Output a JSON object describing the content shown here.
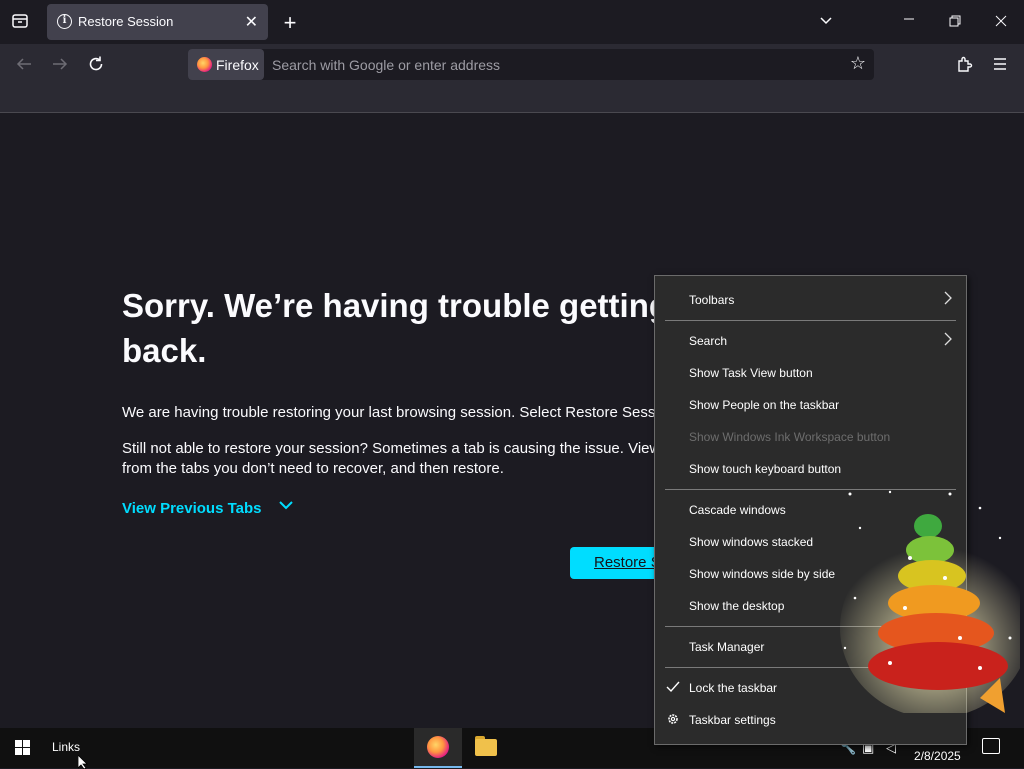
{
  "browser": {
    "tab": {
      "title": "Restore Session"
    },
    "identity_label": "Firefox",
    "url_placeholder": "Search with Google or enter address"
  },
  "page": {
    "heading": "Sorry. We’re having trouble getting back.",
    "para1": "We are having trouble restoring your last browsing session. Select Restore Sessio",
    "para2_line1": "Still not able to restore your session? Sometimes a tab is causing the issue. View",
    "para2_line2": "from the tabs you don’t need to recover, and then restore.",
    "view_previous_tabs": "View Previous Tabs",
    "restore_button": "Restore S"
  },
  "context_menu": {
    "items": [
      {
        "label": "Toolbars"
      },
      {
        "label": "Search"
      },
      {
        "label": "Show Task View button"
      },
      {
        "label": "Show People on the taskbar"
      },
      {
        "label": "Show Windows Ink Workspace button",
        "disabled": true
      },
      {
        "label": "Show touch keyboard button"
      },
      {
        "label": "Cascade windows"
      },
      {
        "label": "Show windows stacked"
      },
      {
        "label": "Show windows side by side"
      },
      {
        "label": "Show the desktop"
      },
      {
        "label": "Task Manager"
      },
      {
        "label": "Lock the taskbar",
        "checked": true
      },
      {
        "label": "Taskbar settings"
      }
    ]
  },
  "taskbar": {
    "links_label": "Links",
    "date": "2/8/2025"
  },
  "icons": [
    "list-all-tabs-icon",
    "info-icon",
    "close-icon",
    "new-tab-icon",
    "chevron-down-icon",
    "minimize-icon",
    "maximize-icon",
    "back-icon",
    "forward-icon",
    "reload-icon",
    "firefox-icon",
    "star-icon",
    "extensions-icon",
    "menu-icon",
    "windows-start-icon",
    "file-explorer-icon",
    "gear-icon",
    "checkmark-icon",
    "chevron-right-icon"
  ],
  "colors": {
    "accent": "#00ddff",
    "page_bg": "#1c1b22",
    "toolbar_bg": "#2b2a33",
    "menu_bg": "#2b2b2b"
  }
}
